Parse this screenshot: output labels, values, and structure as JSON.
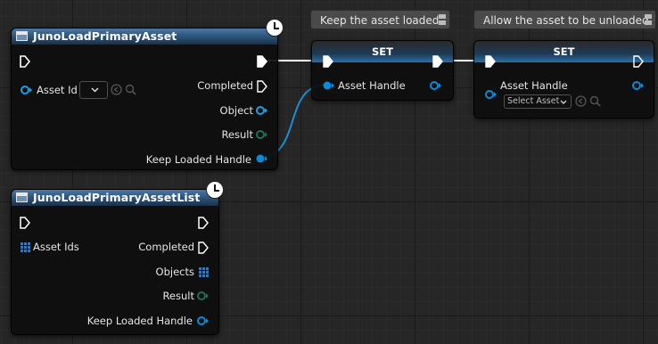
{
  "comments": {
    "left": "Keep the asset loaded",
    "right": "Allow the asset to be unloaded"
  },
  "node1": {
    "title": "JunoLoadPrimaryAsset",
    "asset_id_label": "Asset Id",
    "completed": "Completed",
    "object": "Object",
    "result": "Result",
    "keep_handle": "Keep Loaded Handle"
  },
  "node2": {
    "title": "JunoLoadPrimaryAssetList",
    "asset_ids_label": "Asset Ids",
    "completed": "Completed",
    "objects": "Objects",
    "result": "Result",
    "keep_handle": "Keep Loaded Handle"
  },
  "set1": {
    "title": "SET",
    "asset_handle": "Asset Handle"
  },
  "set2": {
    "title": "SET",
    "asset_handle": "Asset Handle",
    "select_asset": "Select Asset"
  },
  "colors": {
    "object_pin": "#1aa0e6",
    "handle_pin": "#0b8ad9",
    "result_pin": "#1f6f56",
    "array_pin": "#1a7fe0",
    "wire_exec": "#ffffff",
    "wire_handle": "#1a8fd8"
  }
}
